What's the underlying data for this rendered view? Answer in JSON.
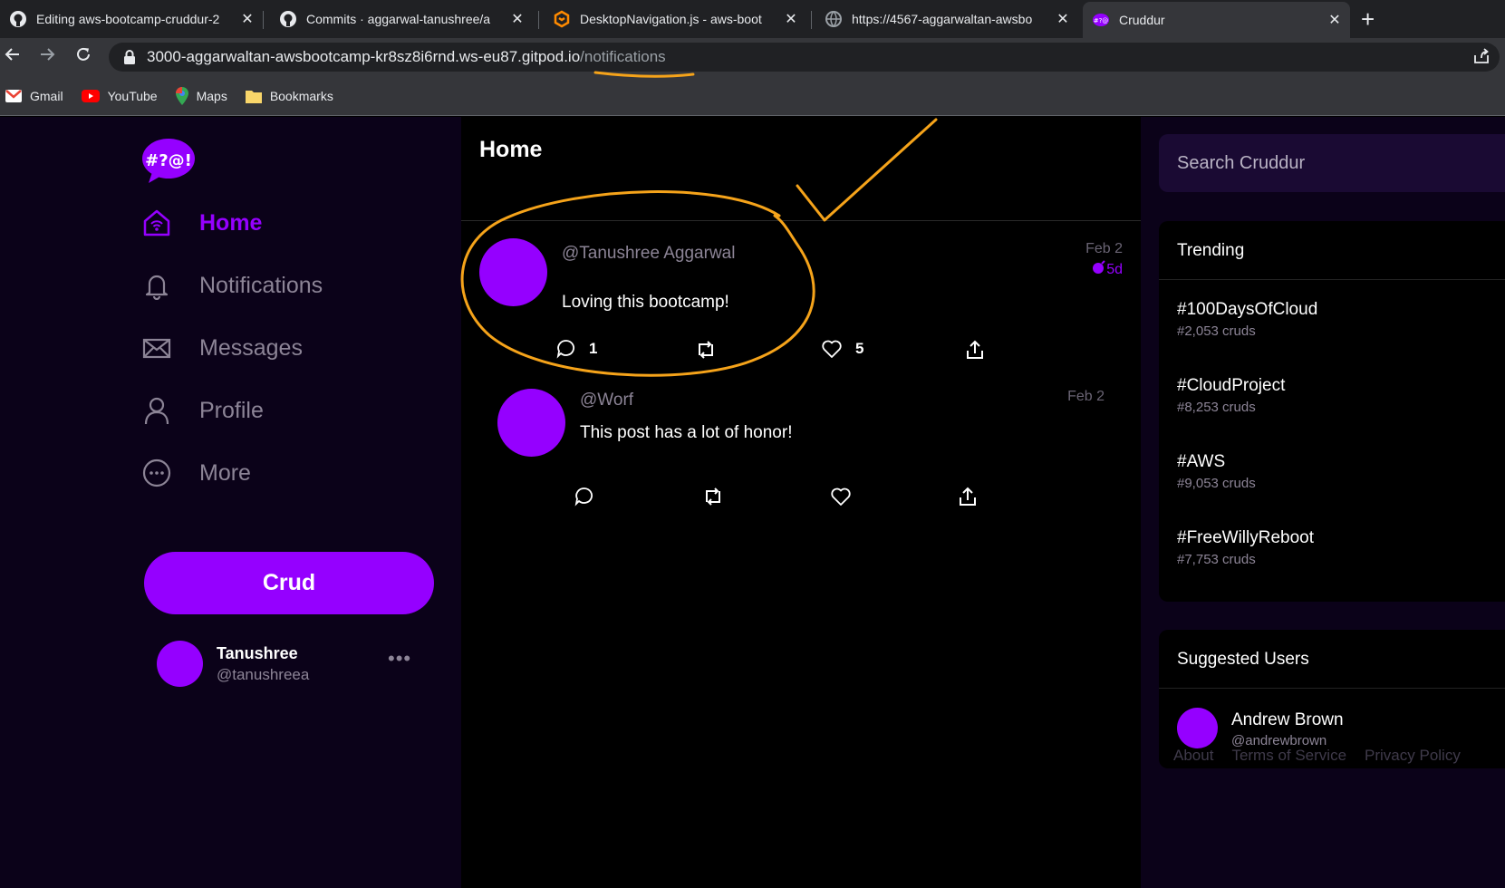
{
  "browser": {
    "tabs": [
      {
        "title": "Editing aws-bootcamp-cruddur-2",
        "icon": "github-icon"
      },
      {
        "title": "Commits · aggarwal-tanushree/a",
        "icon": "github-icon"
      },
      {
        "title": "DesktopNavigation.js - aws-boot",
        "icon": "gitpod-icon"
      },
      {
        "title": "https://4567-aggarwaltan-awsbo",
        "icon": "globe-icon"
      },
      {
        "title": "Cruddur",
        "icon": "cruddur-icon"
      }
    ],
    "url_host": "3000-aggarwaltan-awsbootcamp-kr8sz8i6rnd.ws-eu87.gitpod.io",
    "url_path": "/notifications",
    "bookmarks": [
      {
        "label": "Gmail",
        "icon": "gmail-icon"
      },
      {
        "label": "YouTube",
        "icon": "youtube-icon"
      },
      {
        "label": "Maps",
        "icon": "maps-icon"
      },
      {
        "label": "Bookmarks",
        "icon": "folder-icon"
      }
    ]
  },
  "nav": {
    "logo_text": "#?@!",
    "items": [
      {
        "label": "Home",
        "icon": "home-icon",
        "active": true
      },
      {
        "label": "Notifications",
        "icon": "bell-icon"
      },
      {
        "label": "Messages",
        "icon": "envelope-icon"
      },
      {
        "label": "Profile",
        "icon": "user-icon"
      },
      {
        "label": "More",
        "icon": "more-circle-icon"
      }
    ],
    "crud_label": "Crud",
    "profile": {
      "name": "Tanushree",
      "handle": "@tanushreea",
      "menu": "•••"
    }
  },
  "feed": {
    "title": "Home",
    "activities": [
      {
        "handle": "@Tanushree Aggarwal",
        "message": "Loving this bootcamp!",
        "time": "Feb 2",
        "expires": "5d",
        "replies": "1",
        "likes": "5"
      },
      {
        "handle": "@Worf",
        "message": "This post has a lot of honor!",
        "time": "Feb 2",
        "expires": "",
        "replies": "",
        "likes": ""
      }
    ]
  },
  "sidebar": {
    "search_placeholder": "Search Cruddur",
    "trending_title": "Trending",
    "trending": [
      {
        "name": "#100DaysOfCloud",
        "count": "#2,053 cruds"
      },
      {
        "name": "#CloudProject",
        "count": "#8,253 cruds"
      },
      {
        "name": "#AWS",
        "count": "#9,053 cruds"
      },
      {
        "name": "#FreeWillyReboot",
        "count": "#7,753 cruds"
      }
    ],
    "suggested_title": "Suggested Users",
    "suggested": [
      {
        "name": "Andrew Brown",
        "handle": "@andrewbrown"
      }
    ],
    "footer": [
      "About",
      "Terms of Service",
      "Privacy Policy"
    ]
  },
  "colors": {
    "accent": "#9500ff",
    "annotation": "#f5a31a",
    "nav_bg": "#0b0219"
  }
}
